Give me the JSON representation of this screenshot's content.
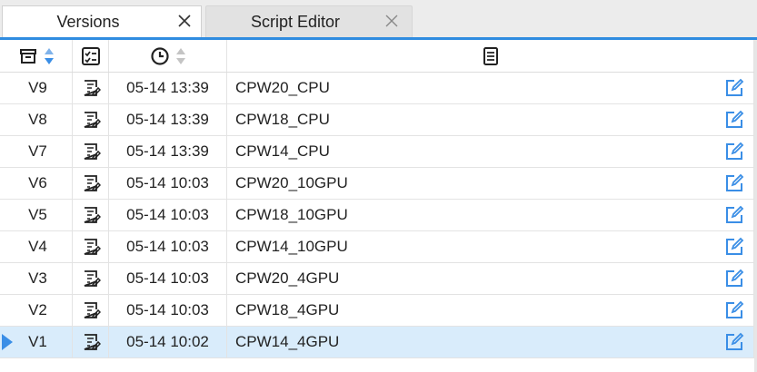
{
  "tabs": [
    {
      "label": "Versions",
      "active": true,
      "close_icon": "close-icon"
    },
    {
      "label": "Script Editor",
      "active": false,
      "close_icon": "close-icon"
    }
  ],
  "accent_color": "#2f8ce0",
  "selected_row_color": "#d9ecfb",
  "edit_icon_color": "#3a8ee6",
  "columns": [
    {
      "icon": "version-icon",
      "sortable": true,
      "sort_active_color": "#3a8ee6"
    },
    {
      "icon": "checklist-icon",
      "sortable": false
    },
    {
      "icon": "clock-icon",
      "sortable": true
    },
    {
      "icon": "document-icon",
      "sortable": false
    }
  ],
  "rows": [
    {
      "version": "V9",
      "time": "05-14 13:39",
      "name": "CPW20_CPU",
      "selected": false
    },
    {
      "version": "V8",
      "time": "05-14 13:39",
      "name": "CPW18_CPU",
      "selected": false
    },
    {
      "version": "V7",
      "time": "05-14 13:39",
      "name": "CPW14_CPU",
      "selected": false
    },
    {
      "version": "V6",
      "time": "05-14 10:03",
      "name": "CPW20_10GPU",
      "selected": false
    },
    {
      "version": "V5",
      "time": "05-14 10:03",
      "name": "CPW18_10GPU",
      "selected": false
    },
    {
      "version": "V4",
      "time": "05-14 10:03",
      "name": "CPW14_10GPU",
      "selected": false
    },
    {
      "version": "V3",
      "time": "05-14 10:03",
      "name": "CPW20_4GPU",
      "selected": false
    },
    {
      "version": "V2",
      "time": "05-14 10:03",
      "name": "CPW18_4GPU",
      "selected": false
    },
    {
      "version": "V1",
      "time": "05-14 10:02",
      "name": "CPW14_4GPU",
      "selected": true
    }
  ]
}
